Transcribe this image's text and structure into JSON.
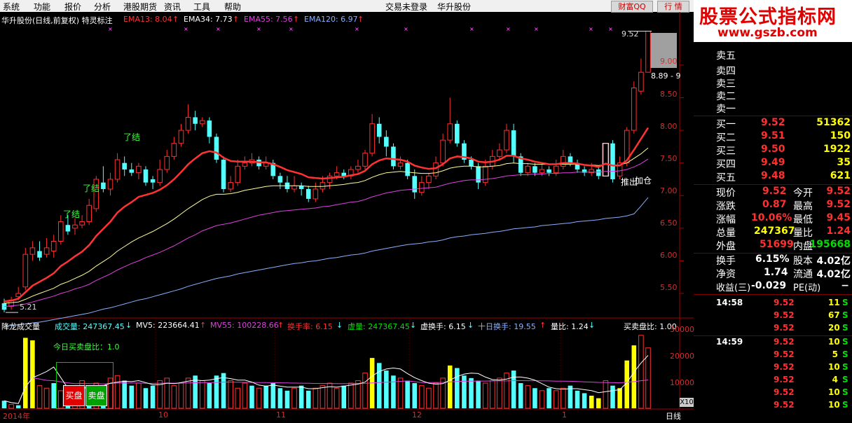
{
  "menu": [
    "系统",
    "功能",
    "报价",
    "分析",
    "港股期货",
    "资讯",
    "工具",
    "帮助"
  ],
  "menu_center": [
    "交易未登录",
    "华升股份"
  ],
  "top_buttons": {
    "caifu": "财富QQ",
    "hangqing": "行 情",
    "win_ctrl": [
      "▽",
      "◇",
      "✕"
    ]
  },
  "watermark": {
    "line1": "股票公式指标网",
    "line2": "www.gszb.com"
  },
  "colors": {
    "up": "#ff3030",
    "down": "#54ffff",
    "yellow": "#ffff00",
    "green": "#00e000",
    "ema13": "#ff3333",
    "ema34": "#ffff99",
    "ema55": "#e040e0",
    "ema120": "#8ab0ff"
  },
  "main_header": {
    "title": "华升股份(日线,前复权) 特灵标注",
    "items": [
      {
        "label": "EMA13: 8.04",
        "arrow": "↑",
        "color": "#ff3333"
      },
      {
        "label": "EMA34: 7.73",
        "arrow": "↑",
        "color": "#ffffff"
      },
      {
        "label": "EMA55: 7.56",
        "arrow": "↑",
        "color": "#e040e0"
      },
      {
        "label": "EMA120: 6.97",
        "arrow": "↑",
        "color": "#8ab0ff"
      }
    ]
  },
  "price_axis": [
    "9.00",
    "8.50",
    "8.00",
    "7.50",
    "7.00",
    "6.50",
    "6.00",
    "5.50"
  ],
  "annotations": {
    "liaojie": [
      "了结",
      "了结",
      "了结"
    ],
    "tuichu": "推出",
    "jiacang": "加仓",
    "high": "9.52",
    "low": "5.21",
    "box": "8.89 - 9"
  },
  "vol_header": {
    "title": "降龙成交量",
    "items": [
      {
        "label": "成交量: 247367.45",
        "arrow": "↓",
        "color": "#54ffff"
      },
      {
        "label": "MV5: 223664.41",
        "arrow": "↑",
        "color": "#ffffff"
      },
      {
        "label": "MV55: 100228.66",
        "arrow": "↑",
        "color": "#e040e0"
      },
      {
        "label": "换手率: 6.15",
        "arrow": "↓",
        "color": "#ff3030"
      },
      {
        "label": "虚量: 247367.45",
        "arrow": "↓",
        "color": "#00e000"
      },
      {
        "label": "虚换手: 6.15",
        "arrow": "↓",
        "color": "#ffffff"
      },
      {
        "label": "十日换手: 19.55",
        "arrow": "↑",
        "color": "#8ab0ff"
      },
      {
        "label": "量比: 1.24",
        "arrow": "↓",
        "color": "#ffffff"
      }
    ],
    "right": "买卖盘比: 1.00"
  },
  "vol_box": {
    "title": "今日买卖盘比：1.0",
    "buy": "买盘",
    "sell": "卖盘"
  },
  "vol_axis": [
    "30000",
    "20000",
    "10000"
  ],
  "vol_unit": "X10",
  "time_axis": [
    "2014年",
    "10",
    "11",
    "12",
    "1"
  ],
  "period": "日线",
  "order_book": {
    "sells": [
      "卖五",
      "卖四",
      "卖三",
      "卖二",
      "卖一"
    ],
    "buys": [
      {
        "label": "买一",
        "price": "9.52",
        "vol": "51362"
      },
      {
        "label": "买二",
        "price": "9.51",
        "vol": "150"
      },
      {
        "label": "买三",
        "price": "9.50",
        "vol": "1922"
      },
      {
        "label": "买四",
        "price": "9.49",
        "vol": "35"
      },
      {
        "label": "买五",
        "price": "9.48",
        "vol": "621"
      }
    ]
  },
  "quote": [
    {
      "l1": "现价",
      "v1": "9.52",
      "l2": "今开",
      "v2": "9.52",
      "c1": "#ff3030",
      "c2": "#ff3030"
    },
    {
      "l1": "涨跌",
      "v1": "0.87",
      "l2": "最高",
      "v2": "9.52",
      "c1": "#ff3030",
      "c2": "#ff3030"
    },
    {
      "l1": "涨幅",
      "v1": "10.06%",
      "l2": "最低",
      "v2": "9.45",
      "c1": "#ff3030",
      "c2": "#ff3030"
    },
    {
      "l1": "总量",
      "v1": "247367",
      "l2": "量比",
      "v2": "1.24",
      "c1": "#ffff00",
      "c2": "#ff3030"
    },
    {
      "l1": "外盘",
      "v1": "51699",
      "l2": "内盘",
      "v2": "195668",
      "c1": "#ff3030",
      "c2": "#00e000"
    },
    {
      "l1": "换手",
      "v1": "6.15%",
      "l2": "股本",
      "v2": "4.02亿",
      "c1": "#ffffff",
      "c2": "#ffffff"
    },
    {
      "l1": "净资",
      "v1": "1.74",
      "l2": "流通",
      "v2": "4.02亿",
      "c1": "#ffffff",
      "c2": "#ffffff"
    },
    {
      "l1": "收益(三)",
      "v1": "-0.029",
      "l2": "PE(动)",
      "v2": "−",
      "c1": "#ffffff",
      "c2": "#ffffff"
    }
  ],
  "ticks": [
    {
      "time": "14:58",
      "price": "9.52",
      "vol": "11",
      "dir": "S"
    },
    {
      "time": "",
      "price": "9.52",
      "vol": "67",
      "dir": "S"
    },
    {
      "time": "",
      "price": "9.52",
      "vol": "20",
      "dir": "S"
    },
    {
      "time": "14:59",
      "price": "9.52",
      "vol": "10",
      "dir": "S"
    },
    {
      "time": "",
      "price": "9.52",
      "vol": "5",
      "dir": "S"
    },
    {
      "time": "",
      "price": "9.52",
      "vol": "10",
      "dir": "S"
    },
    {
      "time": "",
      "price": "9.52",
      "vol": "4",
      "dir": "S"
    },
    {
      "time": "",
      "price": "9.52",
      "vol": "10",
      "dir": "S"
    },
    {
      "time": "",
      "price": "9.52",
      "vol": "10",
      "dir": "S"
    }
  ],
  "chart_data": {
    "type": "candlestick",
    "price_range": [
      5.2,
      9.6
    ],
    "volume_range": [
      0,
      32000
    ],
    "candles": [
      [
        5.35,
        5.25,
        5.42,
        5.21
      ],
      [
        5.3,
        5.4,
        5.45,
        5.25
      ],
      [
        5.45,
        5.5,
        5.6,
        5.4
      ],
      [
        5.6,
        6.1,
        6.2,
        5.55
      ],
      [
        6.1,
        6.2,
        6.3,
        6.0
      ],
      [
        6.15,
        6.05,
        6.3,
        6.0
      ],
      [
        6.1,
        6.2,
        6.35,
        6.05
      ],
      [
        6.15,
        6.3,
        6.4,
        6.05
      ],
      [
        6.3,
        6.6,
        6.7,
        6.25
      ],
      [
        6.55,
        6.45,
        6.7,
        6.4
      ],
      [
        6.5,
        6.55,
        6.65,
        6.4
      ],
      [
        6.55,
        6.6,
        6.7,
        6.5
      ],
      [
        6.6,
        6.85,
        6.95,
        6.55
      ],
      [
        6.8,
        7.25,
        7.3,
        6.75
      ],
      [
        7.2,
        7.1,
        7.45,
        7.05
      ],
      [
        7.1,
        7.25,
        7.35,
        7.0
      ],
      [
        7.25,
        7.55,
        7.65,
        7.2
      ],
      [
        7.5,
        7.4,
        7.6,
        7.3
      ],
      [
        7.4,
        7.35,
        7.5,
        7.3
      ],
      [
        7.35,
        7.45,
        7.5,
        7.25
      ],
      [
        7.4,
        7.2,
        7.45,
        7.15
      ],
      [
        7.25,
        7.2,
        7.3,
        7.1
      ],
      [
        7.2,
        7.4,
        7.55,
        7.15
      ],
      [
        7.4,
        7.6,
        7.7,
        7.35
      ],
      [
        7.6,
        7.8,
        7.9,
        7.55
      ],
      [
        7.8,
        8.0,
        8.1,
        7.75
      ],
      [
        8.0,
        8.2,
        8.4,
        7.95
      ],
      [
        8.2,
        8.1,
        8.3,
        8.0
      ],
      [
        8.1,
        8.15,
        8.2,
        8.05
      ],
      [
        8.15,
        7.9,
        8.2,
        7.8
      ],
      [
        7.9,
        7.55,
        7.95,
        7.5
      ],
      [
        7.55,
        7.1,
        7.6,
        7.05
      ],
      [
        7.1,
        7.2,
        7.3,
        7.05
      ],
      [
        7.2,
        7.45,
        7.55,
        7.15
      ],
      [
        7.45,
        7.5,
        7.6,
        7.4
      ],
      [
        7.5,
        7.55,
        7.65,
        7.45
      ],
      [
        7.55,
        7.45,
        7.6,
        7.4
      ],
      [
        7.45,
        7.5,
        7.6,
        7.4
      ],
      [
        7.5,
        7.3,
        7.55,
        7.25
      ],
      [
        7.3,
        7.2,
        7.35,
        7.1
      ],
      [
        7.2,
        7.1,
        7.3,
        7.05
      ],
      [
        7.1,
        7.15,
        7.3,
        7.05
      ],
      [
        7.15,
        7.1,
        7.2,
        7.0
      ],
      [
        7.1,
        6.95,
        7.15,
        6.9
      ],
      [
        6.95,
        7.1,
        7.2,
        6.9
      ],
      [
        7.1,
        7.2,
        7.3,
        7.05
      ],
      [
        7.2,
        7.3,
        7.35,
        7.1
      ],
      [
        7.3,
        7.35,
        7.45,
        7.25
      ],
      [
        7.35,
        7.3,
        7.4,
        7.25
      ],
      [
        7.3,
        7.4,
        7.45,
        7.25
      ],
      [
        7.4,
        7.45,
        7.55,
        7.35
      ],
      [
        7.45,
        7.65,
        7.7,
        7.4
      ],
      [
        7.65,
        8.1,
        8.25,
        7.6
      ],
      [
        8.1,
        7.9,
        8.2,
        7.8
      ],
      [
        7.9,
        7.75,
        8.0,
        7.6
      ],
      [
        7.75,
        7.45,
        7.8,
        7.4
      ],
      [
        7.45,
        7.5,
        7.6,
        7.4
      ],
      [
        7.5,
        7.3,
        7.55,
        7.25
      ],
      [
        7.3,
        7.05,
        7.4,
        6.95
      ],
      [
        7.05,
        7.2,
        7.3,
        7.0
      ],
      [
        7.2,
        7.3,
        7.35,
        7.1
      ],
      [
        7.3,
        7.5,
        7.6,
        7.25
      ],
      [
        7.5,
        7.85,
        7.95,
        7.45
      ],
      [
        7.85,
        8.1,
        8.5,
        7.8
      ],
      [
        8.1,
        7.8,
        8.15,
        7.75
      ],
      [
        7.8,
        7.55,
        7.85,
        7.5
      ],
      [
        7.55,
        7.45,
        7.6,
        7.4
      ],
      [
        7.45,
        7.2,
        7.5,
        7.1
      ],
      [
        7.2,
        7.45,
        7.55,
        7.15
      ],
      [
        7.45,
        7.6,
        7.7,
        7.4
      ],
      [
        7.6,
        7.7,
        7.8,
        7.55
      ],
      [
        7.7,
        8.0,
        8.1,
        7.65
      ],
      [
        8.0,
        7.6,
        8.1,
        7.5
      ],
      [
        7.6,
        7.35,
        7.65,
        7.3
      ],
      [
        7.35,
        7.45,
        7.5,
        7.3
      ],
      [
        7.45,
        7.35,
        7.5,
        7.3
      ],
      [
        7.35,
        7.4,
        7.5,
        7.3
      ],
      [
        7.4,
        7.35,
        7.45,
        7.3
      ],
      [
        7.35,
        7.45,
        7.55,
        7.3
      ],
      [
        7.45,
        7.6,
        7.7,
        7.4
      ],
      [
        7.6,
        7.5,
        7.65,
        7.45
      ],
      [
        7.5,
        7.4,
        7.55,
        7.35
      ],
      [
        7.4,
        7.35,
        7.45,
        7.3
      ],
      [
        7.35,
        7.4,
        7.5,
        7.3
      ],
      [
        7.4,
        7.3,
        7.45,
        7.25
      ],
      [
        7.3,
        7.8,
        7.8,
        7.3
      ],
      [
        7.8,
        7.25,
        7.85,
        7.2
      ],
      [
        7.3,
        7.5,
        7.6,
        7.25
      ],
      [
        7.5,
        8.0,
        8.05,
        7.45
      ],
      [
        8.0,
        8.65,
        8.75,
        7.95
      ],
      [
        8.6,
        8.89,
        9.1,
        8.55
      ],
      [
        8.89,
        9.52,
        9.52,
        8.89
      ]
    ],
    "volumes": [
      3000,
      1500,
      1200,
      28000,
      27000,
      9000,
      8000,
      10000,
      7000,
      6000,
      7000,
      11000,
      9000,
      10000,
      8000,
      12000,
      13000,
      11000,
      9000,
      10000,
      8000,
      9000,
      11000,
      12000,
      9000,
      10000,
      12000,
      13000,
      11000,
      10000,
      13000,
      14000,
      11000,
      8000,
      10000,
      9000,
      8000,
      9000,
      10000,
      8000,
      7000,
      8000,
      9000,
      7000,
      8000,
      9000,
      10000,
      8000,
      9000,
      10000,
      11000,
      14000,
      20000,
      18000,
      15000,
      13000,
      12000,
      11000,
      10000,
      9000,
      8000,
      10000,
      12000,
      17000,
      16000,
      13000,
      12000,
      11000,
      10000,
      11000,
      12000,
      14000,
      15000,
      10000,
      9000,
      8000,
      7000,
      8000,
      7000,
      8000,
      9000,
      7000,
      6000,
      5000,
      4000,
      11000,
      9000,
      8000,
      19000,
      25000,
      29000,
      24000
    ],
    "volume_colors": [
      "c",
      "r",
      "c",
      "y",
      "y",
      "r",
      "r",
      "c",
      "r",
      "c",
      "r",
      "r",
      "c",
      "r",
      "c",
      "r",
      "r",
      "c",
      "c",
      "r",
      "c",
      "c",
      "r",
      "r",
      "r",
      "r",
      "r",
      "c",
      "r",
      "c",
      "c",
      "c",
      "r",
      "r",
      "r",
      "c",
      "r",
      "c",
      "c",
      "c",
      "c",
      "r",
      "c",
      "c",
      "r",
      "r",
      "r",
      "r",
      "c",
      "r",
      "r",
      "r",
      "y",
      "c",
      "c",
      "c",
      "r",
      "c",
      "c",
      "r",
      "r",
      "r",
      "r",
      "y",
      "c",
      "c",
      "c",
      "c",
      "r",
      "r",
      "r",
      "r",
      "c",
      "c",
      "r",
      "c",
      "r",
      "c",
      "r",
      "r",
      "c",
      "c",
      "c",
      "y",
      "y",
      "r",
      "c",
      "y",
      "y",
      "y",
      "r"
    ],
    "ema13": [
      5.38,
      5.39,
      5.42,
      5.52,
      5.62,
      5.68,
      5.74,
      5.81,
      5.92,
      5.99,
      6.07,
      6.14,
      6.24,
      6.38,
      6.49,
      6.6,
      6.74,
      6.83,
      6.9,
      6.98,
      7.01,
      7.04,
      7.09,
      7.16,
      7.25,
      7.36,
      7.48,
      7.57,
      7.65,
      7.68,
      7.66,
      7.58,
      7.53,
      7.52,
      7.52,
      7.52,
      7.51,
      7.51,
      7.48,
      7.44,
      7.39,
      7.36,
      7.33,
      7.28,
      7.27,
      7.26,
      7.27,
      7.28,
      7.29,
      7.31,
      7.33,
      7.38,
      7.48,
      7.54,
      7.57,
      7.56,
      7.55,
      7.52,
      7.46,
      7.43,
      7.41,
      7.42,
      7.48,
      7.57,
      7.6,
      7.59,
      7.57,
      7.52,
      7.51,
      7.52,
      7.55,
      7.61,
      7.61,
      7.57,
      7.55,
      7.52,
      7.5,
      7.48,
      7.48,
      7.5,
      7.5,
      7.49,
      7.47,
      7.46,
      7.44,
      7.49,
      7.46,
      7.46,
      7.54,
      7.7,
      7.87,
      8.04
    ],
    "ema34": [
      5.35,
      5.36,
      5.37,
      5.41,
      5.46,
      5.5,
      5.54,
      5.58,
      5.64,
      5.68,
      5.73,
      5.78,
      5.84,
      5.92,
      5.99,
      6.06,
      6.15,
      6.22,
      6.29,
      6.35,
      6.4,
      6.45,
      6.51,
      6.57,
      6.64,
      6.72,
      6.8,
      6.87,
      6.94,
      6.99,
      7.02,
      7.02,
      7.03,
      7.05,
      7.08,
      7.1,
      7.12,
      7.14,
      7.15,
      7.15,
      7.15,
      7.15,
      7.15,
      7.14,
      7.14,
      7.14,
      7.15,
      7.16,
      7.17,
      7.19,
      7.2,
      7.23,
      7.28,
      7.32,
      7.35,
      7.36,
      7.37,
      7.36,
      7.35,
      7.34,
      7.34,
      7.35,
      7.38,
      7.42,
      7.44,
      7.45,
      7.45,
      7.44,
      7.44,
      7.45,
      7.46,
      7.49,
      7.5,
      7.49,
      7.49,
      7.48,
      7.48,
      7.48,
      7.48,
      7.48,
      7.48,
      7.48,
      7.47,
      7.47,
      7.46,
      7.48,
      7.47,
      7.47,
      7.5,
      7.57,
      7.64,
      7.73
    ],
    "ema55": [
      5.3,
      5.31,
      5.32,
      5.34,
      5.37,
      5.4,
      5.43,
      5.46,
      5.5,
      5.53,
      5.57,
      5.6,
      5.64,
      5.7,
      5.75,
      5.8,
      5.86,
      5.91,
      5.96,
      6.0,
      6.05,
      6.09,
      6.13,
      6.18,
      6.23,
      6.29,
      6.35,
      6.4,
      6.46,
      6.5,
      6.54,
      6.56,
      6.58,
      6.61,
      6.64,
      6.67,
      6.7,
      6.72,
      6.74,
      6.76,
      6.77,
      6.78,
      6.79,
      6.8,
      6.81,
      6.83,
      6.84,
      6.86,
      6.88,
      6.9,
      6.91,
      6.94,
      6.98,
      7.01,
      7.04,
      7.06,
      7.08,
      7.09,
      7.1,
      7.11,
      7.12,
      7.13,
      7.16,
      7.19,
      7.21,
      7.23,
      7.24,
      7.24,
      7.25,
      7.26,
      7.28,
      7.3,
      7.31,
      7.32,
      7.32,
      7.33,
      7.33,
      7.34,
      7.34,
      7.35,
      7.35,
      7.36,
      7.36,
      7.36,
      7.36,
      7.37,
      7.37,
      7.38,
      7.4,
      7.44,
      7.49,
      7.56
    ],
    "ema120": [
      5.0,
      5.01,
      5.02,
      5.03,
      5.05,
      5.06,
      5.08,
      5.1,
      5.12,
      5.14,
      5.16,
      5.18,
      5.2,
      5.23,
      5.26,
      5.28,
      5.31,
      5.34,
      5.37,
      5.4,
      5.42,
      5.45,
      5.48,
      5.51,
      5.54,
      5.57,
      5.61,
      5.64,
      5.67,
      5.7,
      5.73,
      5.75,
      5.77,
      5.8,
      5.82,
      5.84,
      5.86,
      5.88,
      5.9,
      5.92,
      5.94,
      5.96,
      5.97,
      5.99,
      6.0,
      6.02,
      6.04,
      6.05,
      6.07,
      6.09,
      6.1,
      6.12,
      6.15,
      6.17,
      6.19,
      6.21,
      6.23,
      6.25,
      6.26,
      6.27,
      6.29,
      6.3,
      6.32,
      6.35,
      6.37,
      6.38,
      6.4,
      6.41,
      6.42,
      6.44,
      6.45,
      6.47,
      6.49,
      6.5,
      6.51,
      6.52,
      6.54,
      6.55,
      6.56,
      6.57,
      6.58,
      6.6,
      6.61,
      6.62,
      6.63,
      6.65,
      6.66,
      6.67,
      6.69,
      6.72,
      6.84,
      6.97
    ]
  }
}
